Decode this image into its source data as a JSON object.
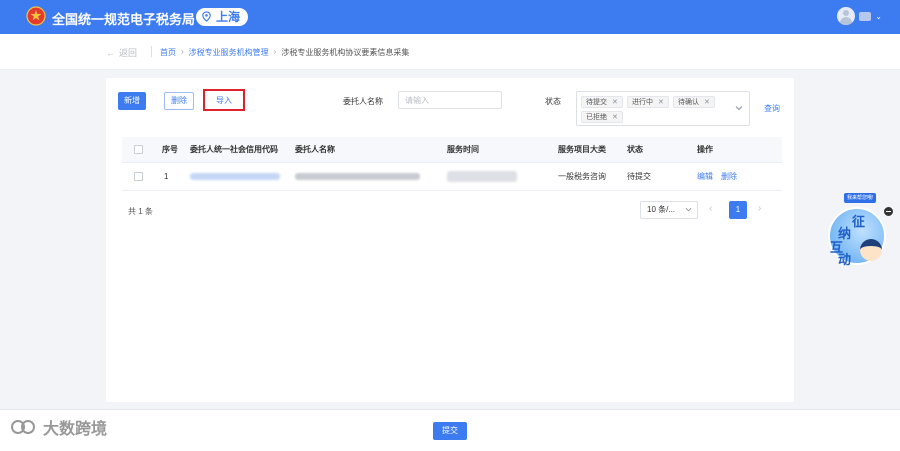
{
  "header": {
    "site_title": "全国统一规范电子税务局",
    "region": "上海"
  },
  "breadcrumb": {
    "back_label": "返回",
    "items": [
      "首页",
      "涉税专业服务机构管理",
      "涉税专业服务机构协议要素信息采集"
    ]
  },
  "toolbar": {
    "add_label": "新增",
    "delete_label": "删除",
    "import_label": "导入"
  },
  "filters": {
    "client_name_label": "委托人名称",
    "client_name_placeholder": "请输入",
    "status_label": "状态",
    "status_tags": [
      "待提交",
      "进行中",
      "待确认",
      "已拒绝"
    ],
    "query_label": "查询"
  },
  "table": {
    "columns": [
      "序号",
      "委托人统一社会信用代码",
      "委托人名称",
      "服务时间",
      "服务项目大类",
      "状态",
      "操作"
    ],
    "rows": [
      {
        "index": "1",
        "service_category": "一般税务咨询",
        "status": "待提交",
        "actions": [
          "编辑",
          "删除"
        ]
      }
    ]
  },
  "pagination": {
    "total_text": "共 1 条",
    "page_size": "10 条/...",
    "current_page": "1"
  },
  "float_widget": {
    "tip": "我来帮您哦!",
    "chars": [
      "征",
      "纳",
      "互",
      "动"
    ]
  },
  "footer": {
    "submit_label": "提交"
  },
  "watermark": {
    "text": "大数跨境"
  },
  "colors": {
    "primary": "#3d7cf0",
    "highlight_border": "#e0202a",
    "header_bg": "#3d7cf0"
  }
}
